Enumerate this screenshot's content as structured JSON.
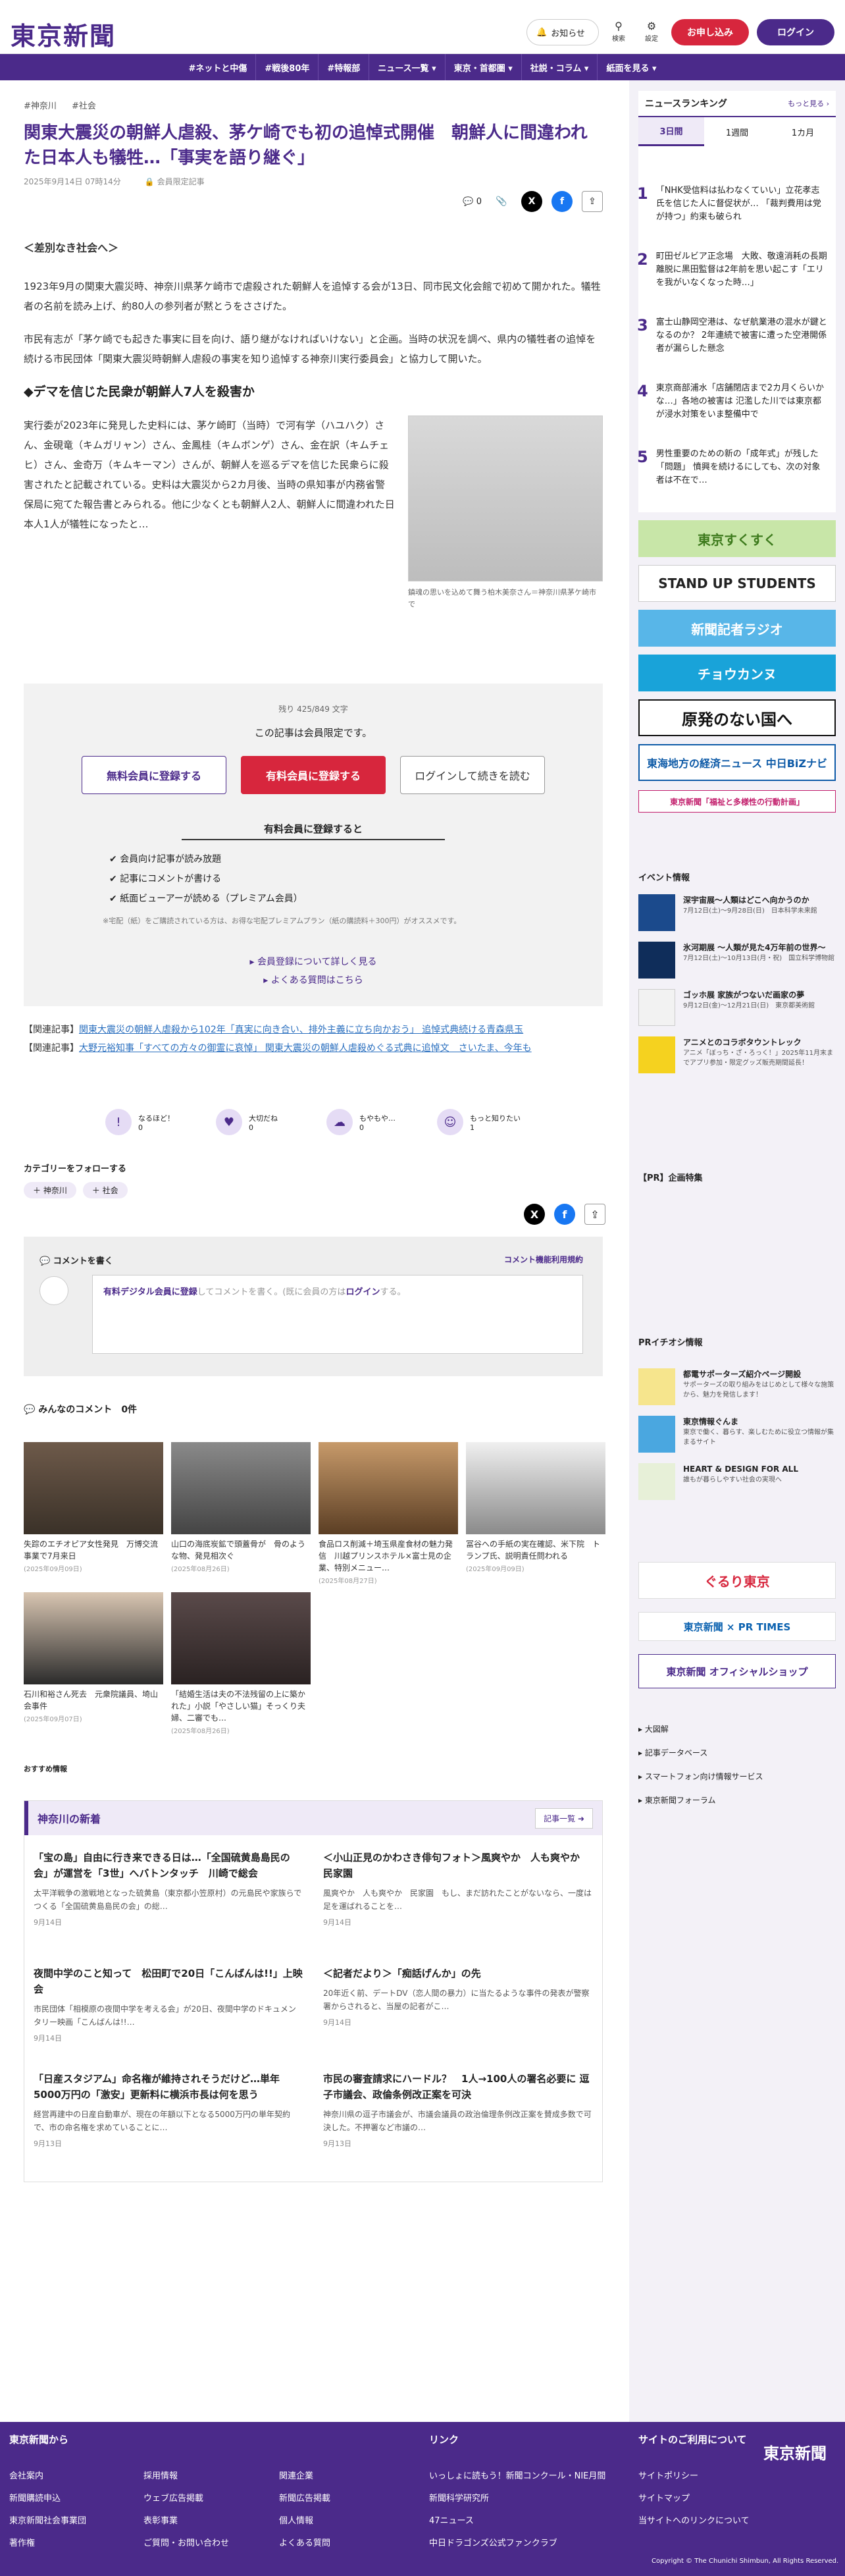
{
  "header": {
    "logo": "東京新聞",
    "notice": "お知らせ",
    "search": "検索",
    "settings": "設定",
    "subscribe": "お申し込み",
    "login": "ログイン"
  },
  "nav": [
    "#ネットと中傷",
    "#戦後80年",
    "#特報部",
    "ニュース一覧 ▾",
    "東京・首都圏 ▾",
    "社説・コラム ▾",
    "紙面を見る ▾"
  ],
  "article": {
    "tags": [
      "#神奈川",
      "#社会"
    ],
    "title": "関東大震災の朝鮮人虐殺、茅ケ崎でも初の追悼式開催　朝鮮人に間違われた日本人も犠牲…「事実を語り継ぐ」",
    "date": "2025年9月14日 07時14分",
    "members_only": "会員限定記事",
    "comment_count": "0",
    "section1": "＜差別なき社会へ＞",
    "p1": "1923年9月の関東大震災時、神奈川県茅ケ崎市で虐殺された朝鮮人を追悼する会が13日、同市民文化会館で初めて開かれた。犠牲者の名前を読み上げ、約80人の参列者が黙とうをささげた。",
    "p2": "市民有志が「茅ケ崎でも起きた事実に目を向け、語り継がなければいけない」と企画。当時の状況を調べ、県内の犠牲者の追悼を続ける市民団体「関東大震災時朝鮮人虐殺の事実を知り追悼する神奈川実行委員会」と協力して開いた。",
    "h2": "◆デマを信じた民衆が朝鮮人7人を殺害か",
    "p3": "実行委が2023年に発見した史料には、茅ケ崎町（当時）で河有学（ハユハク）さん、金硯竜（キムガリャン）さん、金鳳桂（キムボンゲ）さん、金在訳（キムチェヒ）さん、金奇万（キムキーマン）さんが、朝鮮人を巡るデマを信じた民衆らに殺害されたと記載されている。史料は大震災から2カ月後、当時の県知事が内務省警保局に宛てた報告書とみられる。他に少なくとも朝鮮人2人、朝鮮人に間違われた日本人1人が犠牲になったと…",
    "caption": "鎮魂の思いを込めて舞う柏木美奈さん＝神奈川県茅ケ崎市で"
  },
  "paywall": {
    "remaining": "残り 425/849 文字",
    "notice": "この記事は会員限定です。",
    "free_btn": "無料会員に登録する",
    "paid_btn": "有料会員に登録する",
    "login_btn": "ログインして続きを読む",
    "benefits_title": "有料会員に登録すると",
    "benefits": [
      "会員向け記事が読み放題",
      "記事にコメントが書ける",
      "紙面ビューアーが読める（プレミアム会員）"
    ],
    "note": "※宅配（紙）をご購読されている方は、お得な宅配プレミアムプラン（紙の購読料＋300円）がオススメです。",
    "link1": "会員登録について詳しく見る",
    "link2": "よくある質問はこちら"
  },
  "related": [
    {
      "label": "【関連記事】",
      "text": "関東大震災の朝鮮人虐殺から102年「真実に向き合い、排外主義に立ち向かおう」 追悼式典続ける青森県玉"
    },
    {
      "label": "【関連記事】",
      "text": "大野元裕知事「すべての方々の御霊に哀悼」 関東大震災の朝鮮人虐殺めぐる式典に追悼文　さいたま、今年も"
    }
  ],
  "reactions": [
    {
      "label": "なるほど！",
      "count": "0"
    },
    {
      "label": "大切だね",
      "count": "0"
    },
    {
      "label": "もやもや…",
      "count": "0"
    },
    {
      "label": "もっと知りたい",
      "count": "1"
    }
  ],
  "follow": {
    "title": "カテゴリーをフォローする",
    "tags": [
      "神奈川",
      "社会"
    ]
  },
  "comment": {
    "title": "コメントを書く",
    "rules": "コメント機能利用規約",
    "prompt_a": "有料デジタル会員に登録",
    "prompt_b": "してコメントを書く。(既に会員の方は",
    "prompt_c": "ログイン",
    "prompt_d": "する。",
    "list_title": "みんなのコメント",
    "list_count": "0件"
  },
  "photos": [
    {
      "t": "失踪のエチオピア女性発見　万博交流事業で7月来日",
      "d": "(2025年09月09日)"
    },
    {
      "t": "山口の海底炭鉱で頭蓋骨が　骨のような物、発見相次ぐ",
      "d": "(2025年08月26日)"
    },
    {
      "t": "食品ロス削減＋埼玉県産食材の魅力発信　川越プリンスホテル×富士見の企業、特別メニュー…",
      "d": "(2025年08月27日)"
    },
    {
      "t": "冨谷への手紙の実在確認、米下院　トランプ氏、説明責任問われる",
      "d": "(2025年09月09日)"
    },
    {
      "t": "石川和裕さん死去　元衆院議員、埼山会事件",
      "d": "(2025年09月07日)"
    },
    {
      "t": "「結婚生活は夫の不法残留の上に築かれた」小説「やさしい猫」そっくり夫婦、二審でも…",
      "d": "(2025年08月26日)"
    }
  ],
  "recommend": "おすすめ情報",
  "kanagawa": {
    "title": "神奈川の新着",
    "more": "記事一覧",
    "items": [
      {
        "t": "「宝の島」自由に行き来できる日は…「全国硫黄島島民の会」が運営を「3世」へバトンタッチ　川崎で総会",
        "s": "太平洋戦争の激戦地となった硫黄島（東京都小笠原村）の元島民や家族らでつくる「全国硫黄島島民の会」の総…",
        "d": "9月14日"
      },
      {
        "t": "＜小山正見のかわさき俳句フォト＞風爽やか　人も爽やか 民家園",
        "s": "風爽やか　人も爽やか　民家園　もし、まだ訪れたことがないなら、一度は足を運ばれることを…",
        "d": "9月14日"
      },
      {
        "t": "夜間中学のこと知って　松田町で20日「こんばんは!!」上映会",
        "s": "市民団体「相模原の夜間中学を考える会」が20日、夜間中学のドキュメンタリー映画「こんばんは!!…",
        "d": "9月14日"
      },
      {
        "t": "＜記者だより＞「痴話げんか」の先",
        "s": "20年近く前、デートDV（恋人間の暴力）に当たるような事件の発表が警察署からされると、当屋の記者がこ…",
        "d": "9月14日"
      },
      {
        "t": "「日産スタジアム」命名権が維持されそうだけど…単年5000万円の「激安」更新料に横浜市長は何を思う",
        "s": "経営再建中の日産自動車が、現在の年額以下となる5000万円の単年契約で、市の命名権を求めていることに…",
        "d": "9月13日"
      },
      {
        "t": "市民の審査請求にハードル？　1人→100人の署名必要に 逗子市議会、政倫条例改正案を可決",
        "s": "神奈川県の逗子市議会が、市議会議員の政治倫理条例改正案を賛成多数で可決した。不押署など市議の…",
        "d": "9月13日"
      }
    ]
  },
  "sidebar": {
    "ranking_title": "ニュースランキング",
    "ranking_more": "もっと見る",
    "tabs": [
      "3日間",
      "1週間",
      "1カ月"
    ],
    "ranks": [
      "「NHK受信料は払わなくていい」立花孝志氏を信じた人に督促状が… 「裁判費用は党が持つ」約束も破られ",
      "町田ゼルビア正念場　大敗、敬遠消耗の長期離脱に黒田監督は2年前を思い起こす「エリを我がいなくなった時…」",
      "富士山静岡空港は、なぜ航業港の混水が鍵となるのか？ 2年連続で被害に遭った空港開係者が漏らした懸念",
      "東京商部浦水「店舗閉店まで2カ月くらいかな…」各地の被害は 氾濫した川では東京都が浸水対策をいま整備中で",
      "男性重要のための新の「成年式」が残した「問題」 憤興を続けるにしても、次の対象者は不在で…"
    ],
    "banners": [
      "東京すくすく",
      "STAND UP STUDENTS",
      "新聞記者ラジオ",
      "チョウカンヌ",
      "原発のない国へ",
      "東海地方の経済ニュース 中日BiZナビ",
      "東京新聞「福祉と多様性の行動計画」"
    ],
    "events_title": "イベント情報",
    "events": [
      {
        "t": "深宇宙展〜人類はどこへ向かうのか",
        "s": "7月12日(土)〜9月28日(日)　日本科学未来館"
      },
      {
        "t": "氷河期展 〜人類が見た4万年前の世界〜",
        "s": "7月12日(土)〜10月13日(月・祝)　国立科学博物館"
      },
      {
        "t": "ゴッホ展 家族がつないだ画家の夢",
        "s": "9月12日(金)〜12月21日(日)　東京都美術館"
      },
      {
        "t": "アニメとのコラボタウントレック",
        "s": "アニメ「ぼっち・ざ・ろっく！」2025年11月末までアプリ参加・限定グッズ販売期間延長！"
      }
    ],
    "pr_title": "【PR】企画特集",
    "pr_event_title": "PRイチオシ情報",
    "pr_items": [
      {
        "t": "都電サポーターズ紹介ページ開設",
        "s": "サポーターズの取り組みをはじめとして様々な施策から、魅力を発信します！"
      },
      {
        "t": "東京情報ぐんま",
        "s": "東京で働く、暮らす、楽しむために役立つ情報が集まるサイト"
      },
      {
        "t": "HEART & DESIGN FOR ALL",
        "s": "誰もが暮らしやすい社会の実現へ"
      }
    ],
    "side_banners": [
      "ぐるり東京",
      "東京新聞 × PR TIMES",
      "東京新聞 オフィシャルショップ"
    ],
    "links": [
      "大図解",
      "記事データベース",
      "スマートフォン向け情報サービス",
      "東京新聞フォーラム"
    ]
  },
  "footer": {
    "col1_title": "東京新聞から",
    "col1": [
      "会社案内",
      "新聞購読申込",
      "東京新聞社会事業団",
      "著作権",
      "採用情報",
      "ウェブ広告掲載",
      "表彰事業",
      "ご質問・お問い合わせ",
      "関連企業",
      "新聞広告掲載",
      "個人情報",
      "よくある質問"
    ],
    "col2_title": "リンク",
    "col2": [
      "いっしょに読もう！新聞コンクール・NIE月間",
      "新聞科学研究所",
      "47ニュース",
      "中日ドラゴンズ公式ファンクラブ"
    ],
    "col3_title": "サイトのご利用について",
    "col3": [
      "サイトポリシー",
      "サイトマップ",
      "当サイトへのリンクについて"
    ],
    "logo": "東京新聞",
    "copyright": "Copyright © The Chunichi Shimbun, All Rights Reserved."
  },
  "colors": {
    "brand": "#4b2a8a",
    "accent": "#d7263d"
  }
}
